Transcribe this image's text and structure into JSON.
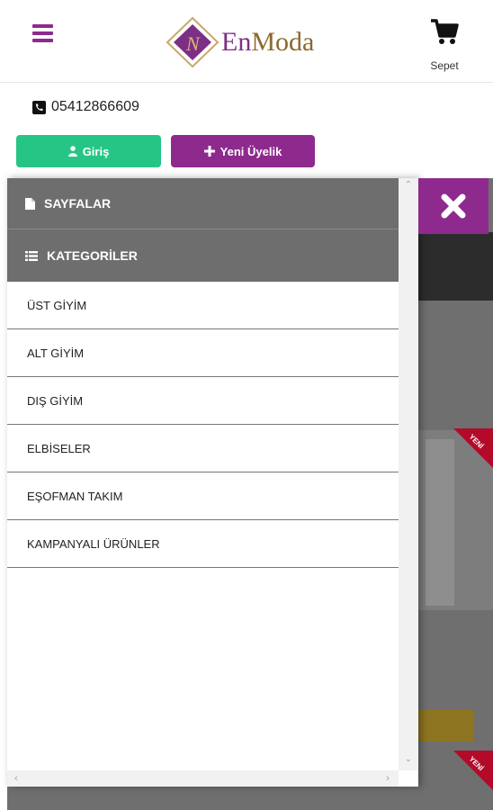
{
  "header": {
    "menu_icon": "hamburger-icon",
    "logo_prefix": "En",
    "logo_suffix": "Moda",
    "cart_icon": "cart-icon",
    "cart_label": "Sepet"
  },
  "contact": {
    "phone_icon": "phone-icon",
    "phone": "05412866609"
  },
  "auth": {
    "login_label": "Giriş",
    "register_label": "Yeni Üyelik"
  },
  "menu": {
    "pages_label": "SAYFALAR",
    "categories_label": "KATEGORİLER",
    "categories": [
      "ÜST GİYİM",
      "ALT GİYİM",
      "DIŞ GİYİM",
      "ELBİSELER",
      "EŞOFMAN TAKIM",
      "KAMPANYALI ÜRÜNLER"
    ]
  },
  "background": {
    "badge_1": "YENİ",
    "badge_2": "YENİ"
  },
  "colors": {
    "brand_purple": "#8e2a8e",
    "login_green": "#27c585",
    "menu_header_gray": "#6e6e6e",
    "badge_red": "#b30a2a"
  }
}
